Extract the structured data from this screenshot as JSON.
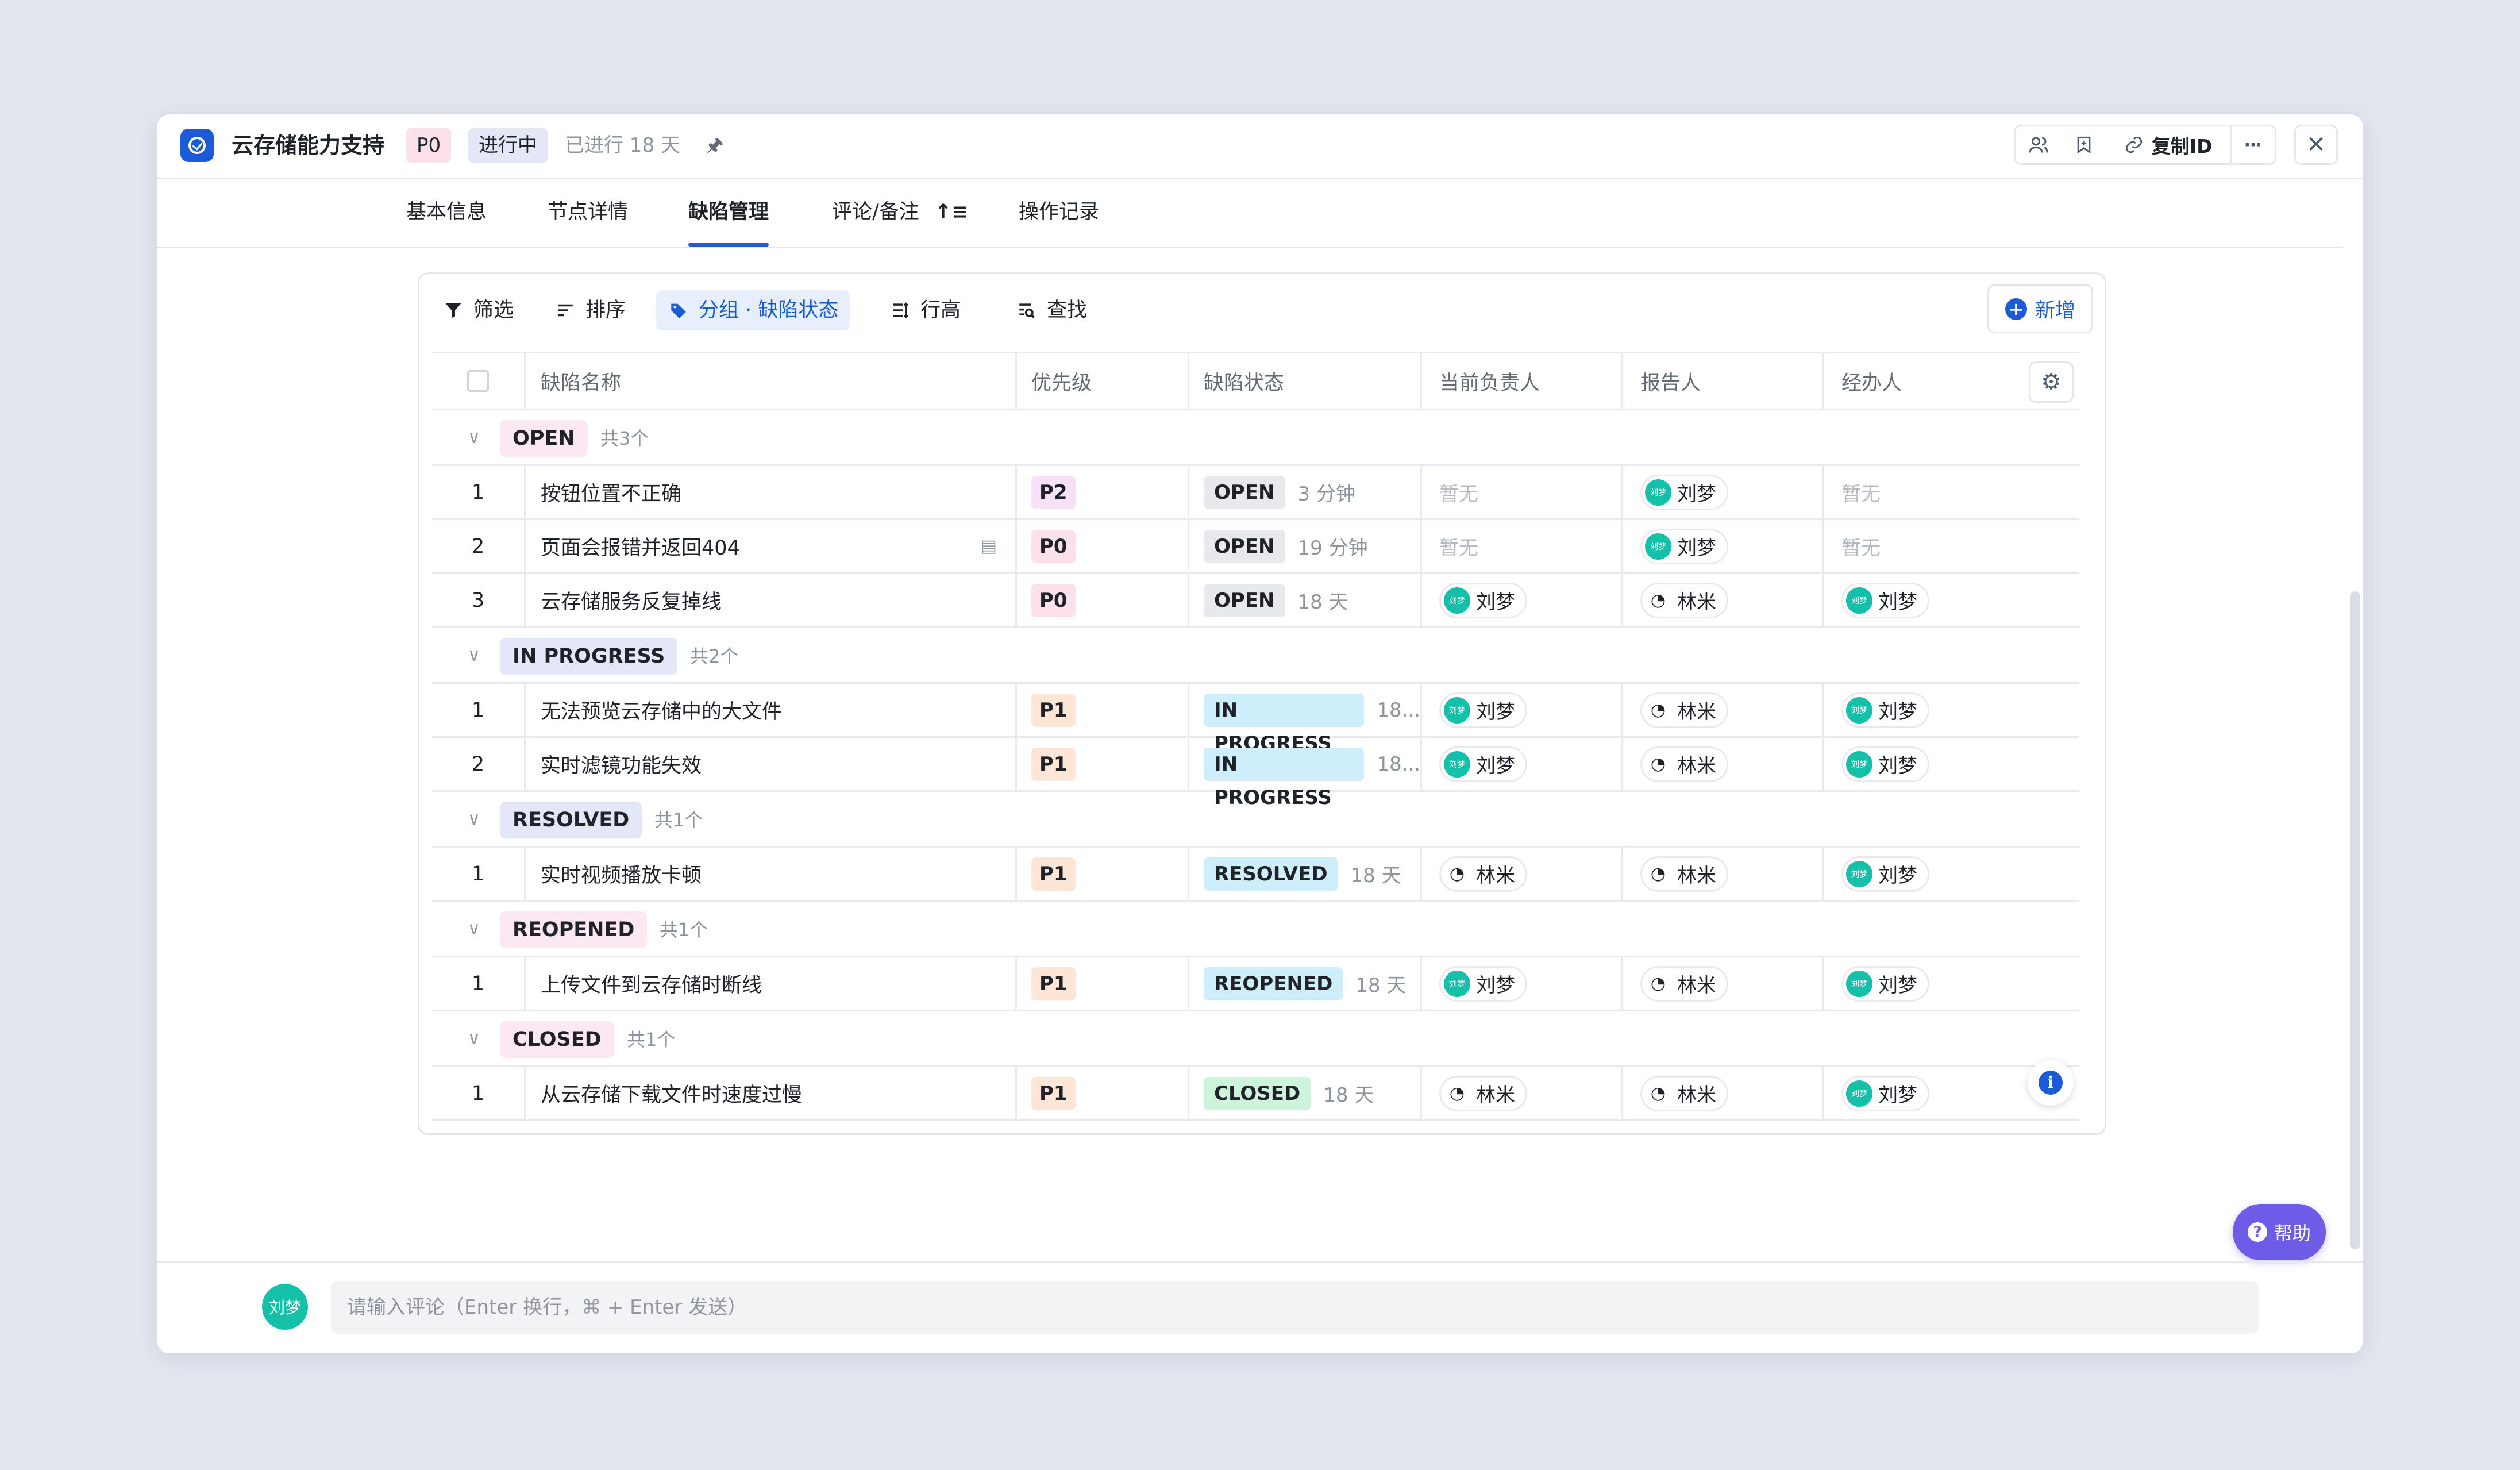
{
  "header": {
    "title": "云存储能力支持",
    "priority": "P0",
    "status": "进行中",
    "elapsed": "已进行 18 天",
    "pin_icon": "pin-icon",
    "copy_id": "复制ID"
  },
  "tabs": [
    {
      "label": "基本信息"
    },
    {
      "label": "节点详情"
    },
    {
      "label": "缺陷管理"
    },
    {
      "label": "评论/备注"
    },
    {
      "label": "操作记录"
    }
  ],
  "active_tab": "缺陷管理",
  "toolbar": {
    "filter": "筛选",
    "sort": "排序",
    "group": "分组 · 缺陷状态",
    "row_height": "行高",
    "find": "查找",
    "add": "新增"
  },
  "table": {
    "columns": [
      "缺陷名称",
      "优先级",
      "缺陷状态",
      "当前负责人",
      "报告人",
      "经办人"
    ],
    "groups": [
      {
        "name": "OPEN",
        "count": "共3个",
        "color": "#fce8f3",
        "rows": [
          {
            "idx": "1",
            "name": "按钮位置不正确",
            "priority": "P2",
            "status": "OPEN",
            "duration": "3 分钟",
            "owner": "暂无",
            "reporter": "刘梦",
            "handler": "暂无",
            "comment": false
          },
          {
            "idx": "2",
            "name": "页面会报错并返回404",
            "priority": "P0",
            "status": "OPEN",
            "duration": "19 分钟",
            "owner": "暂无",
            "reporter": "刘梦",
            "handler": "暂无",
            "comment": true
          },
          {
            "idx": "3",
            "name": "云存储服务反复掉线",
            "priority": "P0",
            "status": "OPEN",
            "duration": "18 天",
            "owner": "刘梦",
            "reporter": "林米",
            "handler": "刘梦",
            "comment": false
          }
        ]
      },
      {
        "name": "IN PROGRESS",
        "count": "共2个",
        "color": "#e3e7f8",
        "rows": [
          {
            "idx": "1",
            "name": "无法预览云存储中的大文件",
            "priority": "P1",
            "status": "IN PROGRESS",
            "duration": "18...",
            "owner": "刘梦",
            "reporter": "林米",
            "handler": "刘梦",
            "comment": false
          },
          {
            "idx": "2",
            "name": "实时滤镜功能失效",
            "priority": "P1",
            "status": "IN PROGRESS",
            "duration": "18...",
            "owner": "刘梦",
            "reporter": "林米",
            "handler": "刘梦",
            "comment": false
          }
        ]
      },
      {
        "name": "RESOLVED",
        "count": "共1个",
        "color": "#e3e7f8",
        "rows": [
          {
            "idx": "1",
            "name": "实时视频播放卡顿",
            "priority": "P1",
            "status": "RESOLVED",
            "duration": "18 天",
            "owner": "林米",
            "reporter": "林米",
            "handler": "刘梦",
            "comment": false
          }
        ]
      },
      {
        "name": "REOPENED",
        "count": "共1个",
        "color": "#fce8f3",
        "rows": [
          {
            "idx": "1",
            "name": "上传文件到云存储时断线",
            "priority": "P1",
            "status": "REOPENED",
            "duration": "18 天",
            "owner": "刘梦",
            "reporter": "林米",
            "handler": "刘梦",
            "comment": false
          }
        ]
      },
      {
        "name": "CLOSED",
        "count": "共1个",
        "color": "#fce8f3",
        "rows": [
          {
            "idx": "1",
            "name": "从云存储下载文件时速度过慢",
            "priority": "P1",
            "status": "CLOSED",
            "duration": "18 天",
            "owner": "林米",
            "reporter": "林米",
            "handler": "刘梦",
            "comment": false
          }
        ]
      }
    ]
  },
  "colors": {
    "accent": "#1b5bd8",
    "priority": {
      "P0": "#fde1ea",
      "P1": "#fde6d6",
      "P2": "#f6e1f6"
    },
    "status": {
      "OPEN": "#e8e9ec",
      "IN PROGRESS": "#cdeefa",
      "RESOLVED": "#cdeefa",
      "REOPENED": "#cdeefa",
      "CLOSED": "#cdf3dc"
    },
    "help": "#6c5ce7"
  },
  "help": {
    "label": "帮助"
  },
  "footer": {
    "avatar": "刘梦",
    "placeholder": "请输入评论（Enter 换行，⌘ + Enter 发送）"
  }
}
